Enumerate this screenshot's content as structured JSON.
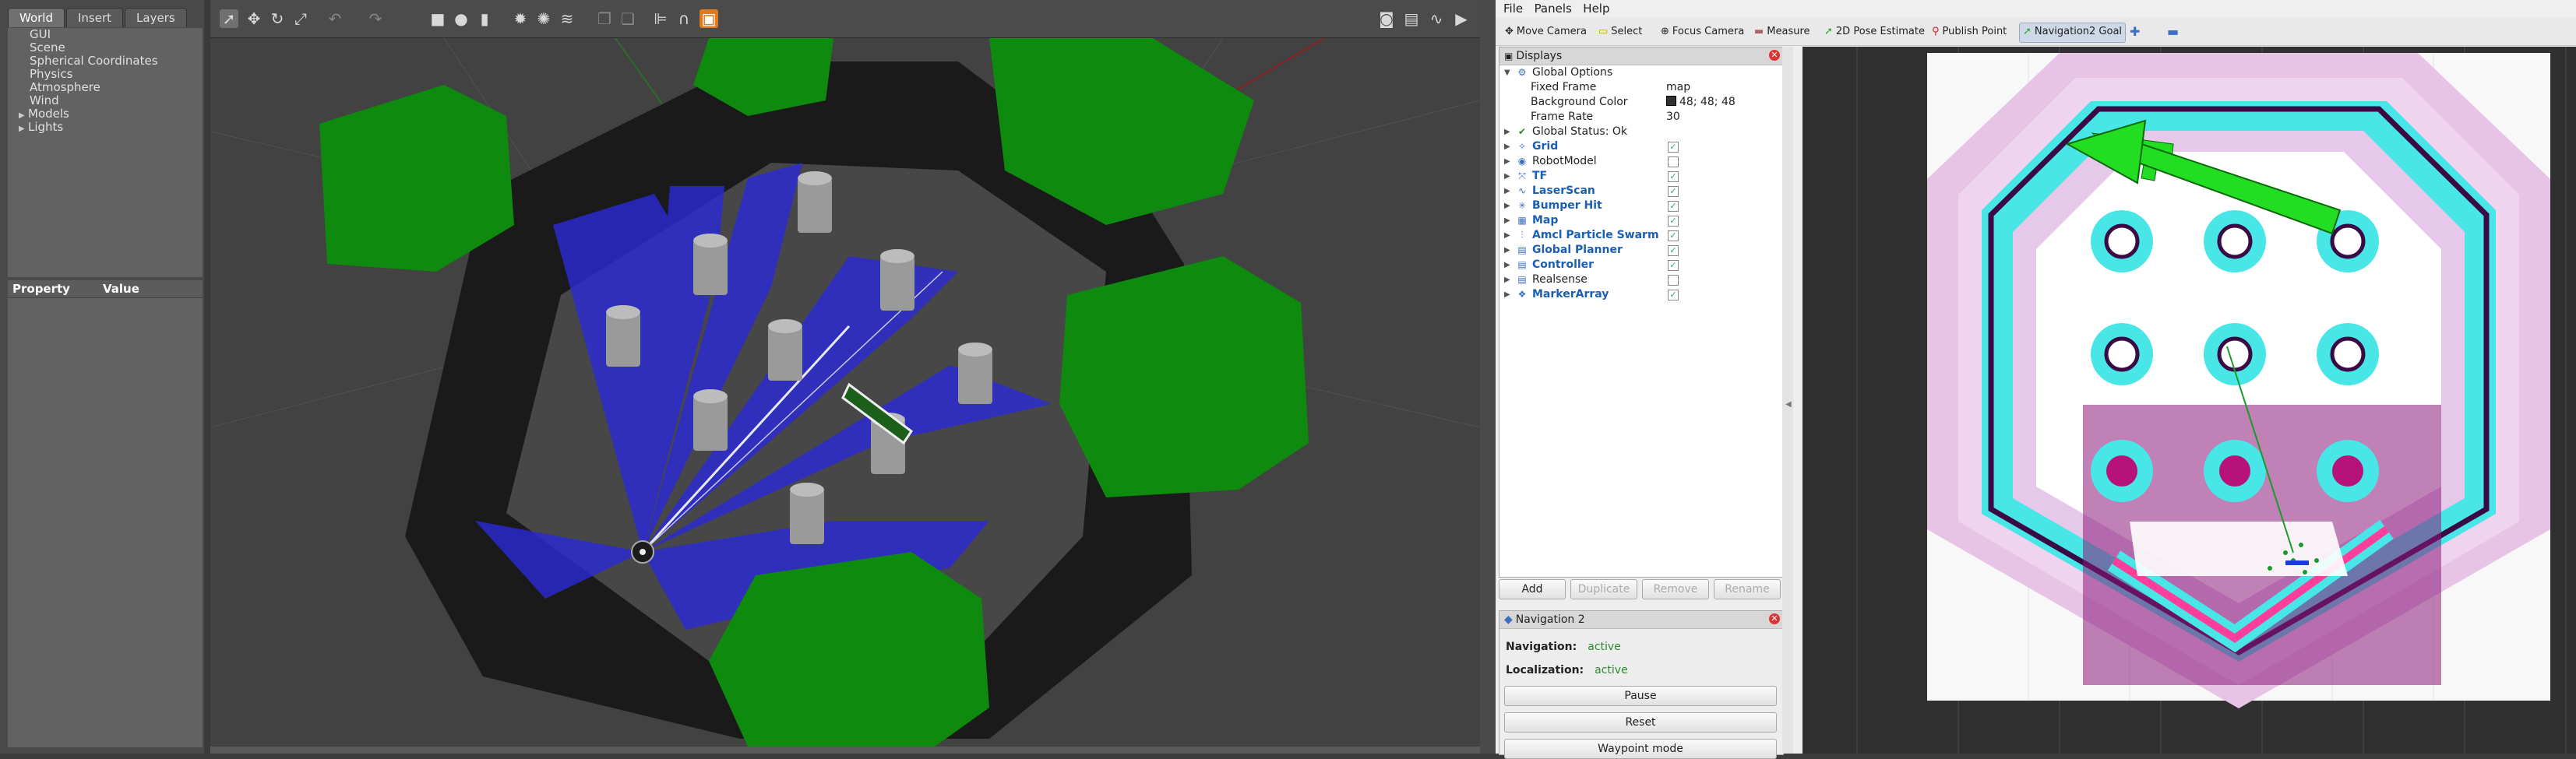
{
  "gazebo": {
    "tabs": [
      "World",
      "Insert",
      "Layers"
    ],
    "world_tree": [
      "GUI",
      "Scene",
      "Spherical Coordinates",
      "Physics",
      "Atmosphere",
      "Wind",
      "Models",
      "Lights"
    ],
    "property_header": {
      "property": "Property",
      "value": "Value"
    }
  },
  "rviz": {
    "menu": [
      "File",
      "Panels",
      "Help"
    ],
    "tools": [
      "Move Camera",
      "Select",
      "Focus Camera",
      "Measure",
      "2D Pose Estimate",
      "Publish Point",
      "Navigation2 Goal"
    ],
    "displays_title": "Displays",
    "global_options": {
      "label": "Global Options",
      "fixed_frame_label": "Fixed Frame",
      "fixed_frame": "map",
      "bg_label": "Background Color",
      "bg_value": "48; 48; 48",
      "rate_label": "Frame Rate",
      "rate_value": "30"
    },
    "global_status": "Global Status: Ok",
    "displays": [
      {
        "name": "Grid",
        "checked": true,
        "blue": true
      },
      {
        "name": "RobotModel",
        "checked": false,
        "blue": false
      },
      {
        "name": "TF",
        "checked": true,
        "blue": true
      },
      {
        "name": "LaserScan",
        "checked": true,
        "blue": true
      },
      {
        "name": "Bumper Hit",
        "checked": true,
        "blue": true
      },
      {
        "name": "Map",
        "checked": true,
        "blue": true
      },
      {
        "name": "Amcl Particle Swarm",
        "checked": true,
        "blue": true
      },
      {
        "name": "Global Planner",
        "checked": true,
        "blue": true
      },
      {
        "name": "Controller",
        "checked": true,
        "blue": true
      },
      {
        "name": "Realsense",
        "checked": false,
        "blue": false
      },
      {
        "name": "MarkerArray",
        "checked": true,
        "blue": true
      }
    ],
    "buttons": {
      "add": "Add",
      "duplicate": "Duplicate",
      "remove": "Remove",
      "rename": "Rename"
    },
    "nav_panel": {
      "title": "Navigation 2",
      "navigation_label": "Navigation:",
      "navigation_value": "active",
      "localization_label": "Localization:",
      "localization_value": "active",
      "pause": "Pause",
      "reset": "Reset",
      "waypoint": "Waypoint mode"
    }
  }
}
